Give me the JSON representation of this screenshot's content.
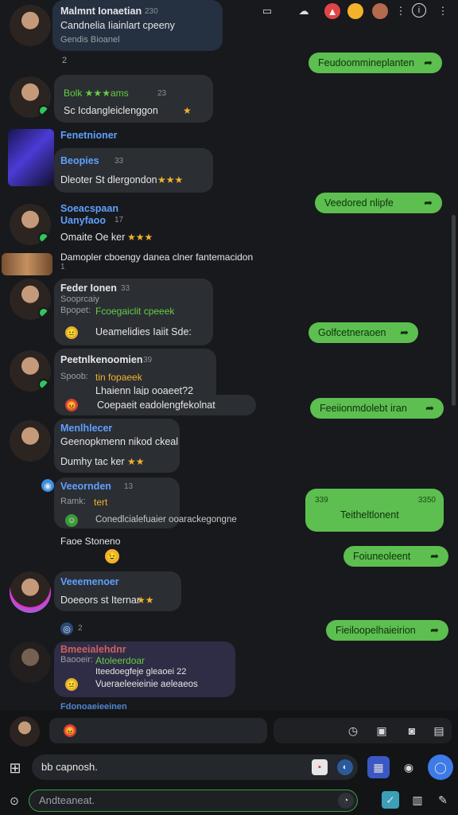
{
  "header": {
    "name": "Malmnt Ionaetian",
    "time": "230",
    "status": "Candnelia Iiainlart cpeeny"
  },
  "left": [
    {
      "name": "Malmnt Ionaetian",
      "text": "Candnelia Iiainlart cpeeny",
      "sub": "Gendis Bioanel",
      "meta": "2"
    },
    {
      "head": "Bolk ★★★ams",
      "text": "Sc Icdangleiclenggon",
      "meta": "23"
    },
    {
      "name": "Fenetnioner",
      "sub": "Beopies",
      "meta": "33"
    },
    {
      "text": "Dleoter St dlergondon"
    },
    {
      "name": "Soeacspaan",
      "sub": "Uanyfaoo",
      "meta": "17",
      "text": "Omaite Oe ker"
    },
    {
      "text": "Damopler cboengy danea clner fantemacidon",
      "meta": "1"
    },
    {
      "name": "Feder Ionen",
      "sub": "Sooprcaiy",
      "extra": "Bpopet:",
      "gline": "Fcoegaiclit cpeeek",
      "meta": "33"
    },
    {
      "text": "Ueamelidies Iaiit Sde:"
    },
    {
      "name": "Peetnlkenoomien",
      "sub": "Spoob:",
      "stline": "tin fopaeek",
      "line2": "Lhaienn lajp ooaeet?2",
      "meta": "39"
    },
    {
      "text": "Coepaeit eadolengfekolnat"
    },
    {
      "name": "Menlhlecer",
      "sub": "Geenopkmenn nikod ckeal",
      "text": "Dumhy tac ker",
      "meta": "1"
    },
    {
      "name": "Veeornden",
      "sub": "Ramk:",
      "stline": "tert",
      "line2": "Conedlcialefuaier ooarackegongne",
      "meta": "13"
    },
    {
      "text": "Faoe Stoneno"
    },
    {
      "name": "Veeemenoer",
      "text": "Doeeors st Iternar"
    },
    {
      "meta": "2"
    },
    {
      "name": "Bmeeialehdnr",
      "sub": "Baooeir:",
      "stline": "Atoleerdoar",
      "line2": "Iteedoegfeje gleaoei 22",
      "text": "Vueraeleeieinie aeleaeos"
    },
    {
      "name": "Fdonoaeieeinen"
    }
  ],
  "right": [
    "Feudoommineplanten",
    "Veedored nlipfe",
    "Golfcetneraoen",
    "Feeiionmdolebt iran",
    "Foiuneoleent",
    "Fieiloopelhaieirion"
  ],
  "card": {
    "time_left": "339",
    "time_right": "3350",
    "text": "Teitheltlonent"
  },
  "composer": {
    "input": "bb capnosh.",
    "bottom": "Andteaneat."
  },
  "icons": {
    "top": [
      "chat-icon",
      "cloud-icon",
      "clock-icon",
      "more-icon",
      "info-icon"
    ],
    "bottom": [
      "grid-icon",
      "camera-icon",
      "send-icon",
      "attach-icon"
    ]
  },
  "colors": {
    "accent": "#5cbf50",
    "bg": "#17191c",
    "bubble": "#2b2e33",
    "name": "#5fa0ff"
  }
}
